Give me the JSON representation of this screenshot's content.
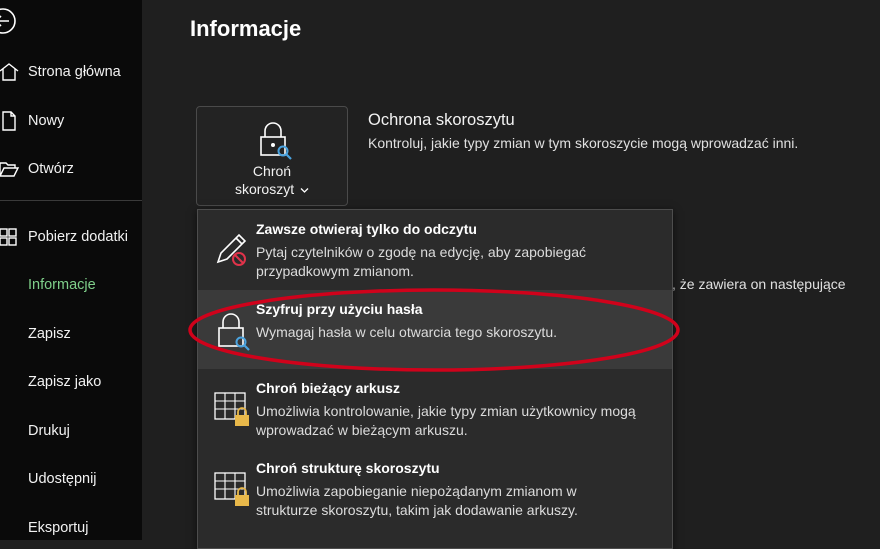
{
  "sidebar": {
    "back_icon": "arrow-left-circle-icon",
    "items": [
      {
        "label": "Strona główna",
        "icon": "home-icon"
      },
      {
        "label": "Nowy",
        "icon": "new-document-icon"
      },
      {
        "label": "Otwórz",
        "icon": "folder-open-icon"
      },
      {
        "label": "Pobierz dodatki",
        "icon": "grid-addins-icon"
      },
      {
        "label": "Informacje"
      },
      {
        "label": "Zapisz"
      },
      {
        "label": "Zapisz jako"
      },
      {
        "label": "Drukuj"
      },
      {
        "label": "Udostępnij"
      },
      {
        "label": "Eksportuj"
      }
    ],
    "active_item": "Informacje",
    "active_color": "#7fcf8a"
  },
  "main": {
    "title": "Informacje",
    "protect_button": {
      "line1": "Chroń",
      "line2": "skoroszyt",
      "icon": "lock-key-icon"
    },
    "protection": {
      "title": "Ochrona skoroszytu",
      "description": "Kontroluj, jakie typy zmian w tym skoroszycie mogą wprowadzać inni."
    },
    "background_partial_text": ", że zawiera on następujące"
  },
  "dropdown": {
    "items": [
      {
        "title": "Zawsze otwieraj tylko do odczytu",
        "desc1": "Pytaj czytelników o zgodę na edycję, aby zapobiegać",
        "desc2": "przypadkowym zmianom.",
        "icon": "pencil-no-edit-icon"
      },
      {
        "title": "Szyfruj przy użyciu hasła",
        "desc1": "Wymagaj hasła w celu otwarcia tego skoroszytu.",
        "icon": "lock-key-icon",
        "highlighted": true
      },
      {
        "title": "Chroń bieżący arkusz",
        "desc1": "Umożliwia kontrolowanie, jakie typy zmian użytkownicy mogą",
        "desc2": "wprowadzać w bieżącym arkuszu.",
        "icon": "sheet-lock-icon"
      },
      {
        "title": "Chroń strukturę skoroszytu",
        "desc1": "Umożliwia zapobieganie niepożądanym zmianom w",
        "desc2": "strukturze skoroszytu, takim jak dodawanie arkuszy.",
        "icon": "workbook-structure-lock-icon"
      }
    ]
  },
  "colors": {
    "highlight_annotation": "#d0021b",
    "accent_blue": "#4aa3df",
    "lock_gold": "#e8b84a"
  }
}
